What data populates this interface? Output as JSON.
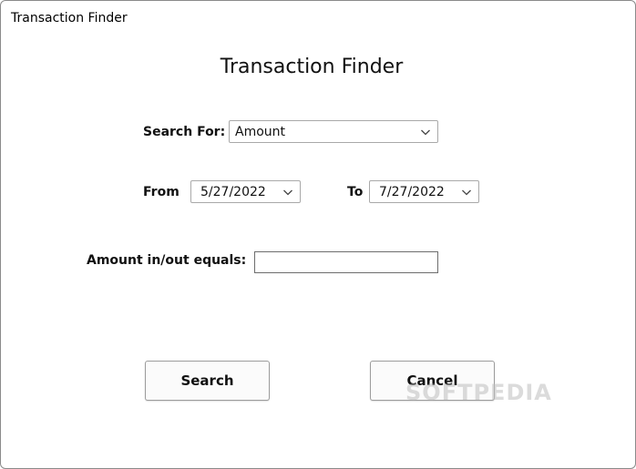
{
  "window": {
    "title": "Transaction Finder"
  },
  "form": {
    "heading": "Transaction Finder",
    "search_for": {
      "label": "Search For:",
      "value": "Amount"
    },
    "from": {
      "label": "From",
      "value": "5/27/2022"
    },
    "to": {
      "label": "To",
      "value": "7/27/2022"
    },
    "amount": {
      "label": "Amount in/out equals:",
      "value": ""
    }
  },
  "buttons": {
    "search": "Search",
    "cancel": "Cancel"
  },
  "watermark": "SOFTPEDIA",
  "icons": {
    "dropdown": "chevron-down-icon"
  }
}
